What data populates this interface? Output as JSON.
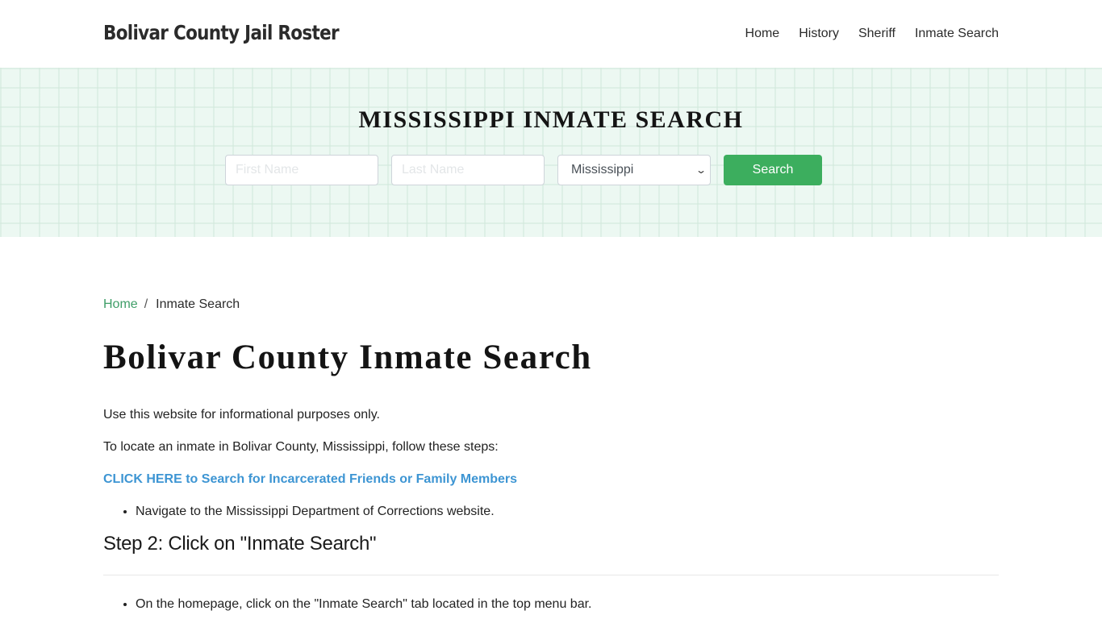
{
  "header": {
    "brand": "Bolivar County Jail Roster",
    "nav": [
      "Home",
      "History",
      "Sheriff",
      "Inmate Search"
    ]
  },
  "hero": {
    "title": "MISSISSIPPI INMATE SEARCH",
    "first_name_placeholder": "First Name",
    "last_name_placeholder": "Last Name",
    "state_selected": "Mississippi",
    "search_label": "Search"
  },
  "breadcrumb": {
    "home": "Home",
    "separator": "/",
    "current": "Inmate Search"
  },
  "main": {
    "title": "Bolivar County Inmate Search",
    "para1": "Use this website for informational purposes only.",
    "para2": "To locate an inmate in Bolivar County, Mississippi, follow these steps:",
    "cta_link": "CLICK HERE to Search for Incarcerated Friends or Family Members",
    "step1_items": [
      "Navigate to the Mississippi Department of Corrections website."
    ],
    "step2_heading": "Step 2: Click on \"Inmate Search\"",
    "step2_items": [
      "On the homepage, click on the \"Inmate Search\" tab located in the top menu bar."
    ]
  },
  "colors": {
    "accent_green": "#3cae5e",
    "link_blue": "#3d95d3",
    "breadcrumb_green": "#3f9e68",
    "hero_bg": "#ecf8f2"
  }
}
